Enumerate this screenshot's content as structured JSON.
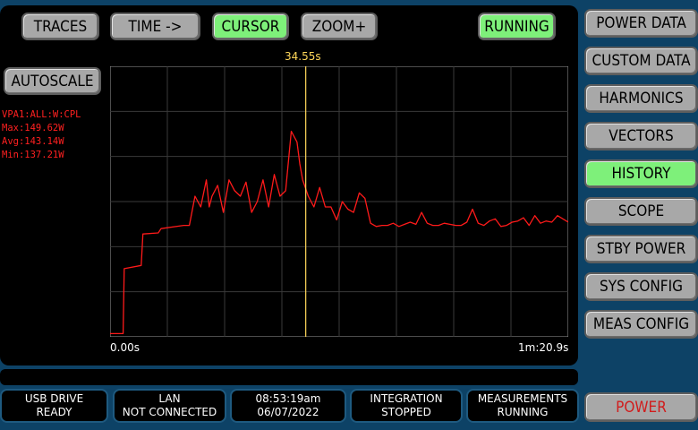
{
  "toolbar": {
    "traces": "TRACES",
    "time": "TIME ->",
    "cursor": "CURSOR",
    "zoom": "ZOOM+",
    "running": "RUNNING"
  },
  "autoscale": "AUTOSCALE",
  "stats": {
    "channel": "VPA1:ALL:W:CPL",
    "max": "Max:149.62W",
    "avg": "Avg:143.14W",
    "min": "Min:137.21W"
  },
  "cursor_time": "34.55s",
  "colors": {
    "trace": "#ff1a1a",
    "cursor": "#ffd75a",
    "active_button": "#7ef07a",
    "button": "#a8a8a8",
    "background": "#0d4266"
  },
  "chart_data": {
    "type": "line",
    "title": "",
    "xlabel": "",
    "ylabel": "",
    "x_start_label": "0.00s",
    "x_end_label": "1m:20.9s",
    "xlim": [
      0,
      80.9
    ],
    "ylim": [
      130,
      155
    ],
    "grid": true,
    "cursor_x": 34.55,
    "series": [
      {
        "x": [
          0,
          2.3,
          2.5,
          5.5,
          5.8,
          8.5,
          9,
          13,
          14,
          15,
          16,
          17,
          17.5,
          18,
          19,
          20,
          21,
          22,
          23,
          24,
          25,
          26,
          27,
          28,
          29,
          30,
          31,
          32,
          33,
          33.5,
          34,
          35,
          36,
          37,
          38,
          39,
          40,
          41,
          42,
          43,
          44,
          45,
          46,
          47,
          48,
          49,
          50,
          51,
          52,
          53,
          54,
          55,
          56,
          57,
          58,
          59,
          60,
          61,
          62,
          63,
          64,
          65,
          66,
          67,
          68,
          69,
          70,
          71,
          72,
          73,
          74,
          75,
          76,
          77,
          78,
          79,
          80.9
        ],
        "values": [
          130.3,
          130.3,
          136.3,
          136.6,
          139.5,
          139.6,
          140,
          140.3,
          140.3,
          143,
          142,
          144.5,
          142,
          143,
          144,
          141.5,
          144.5,
          143.5,
          143,
          144.3,
          141.5,
          142.5,
          144.5,
          142,
          145,
          143,
          143.5,
          149,
          148,
          146,
          144.5,
          143,
          142,
          143.8,
          142,
          142,
          140.8,
          142.5,
          141.8,
          141.5,
          143.3,
          142.8,
          140.5,
          140.2,
          140.3,
          140.3,
          140.5,
          140.2,
          140.4,
          140.6,
          140.4,
          141.5,
          140.5,
          140.3,
          140.3,
          140.5,
          140.4,
          140.3,
          140.3,
          140.6,
          141.8,
          140.5,
          140.3,
          140.7,
          140.9,
          140.2,
          140.3,
          140.6,
          140.7,
          141,
          140.3,
          141.2,
          140.5,
          140.7,
          140.6,
          141.2,
          140.6
        ]
      }
    ]
  },
  "sidebar": {
    "items": [
      {
        "label": "POWER DATA",
        "active": false
      },
      {
        "label": "CUSTOM DATA",
        "active": false
      },
      {
        "label": "HARMONICS",
        "active": false
      },
      {
        "label": "VECTORS",
        "active": false
      },
      {
        "label": "HISTORY",
        "active": true
      },
      {
        "label": "SCOPE",
        "active": false
      },
      {
        "label": "STBY POWER",
        "active": false
      },
      {
        "label": "SYS CONFIG",
        "active": false
      },
      {
        "label": "MEAS CONFIG",
        "active": false
      }
    ],
    "power": "POWER"
  },
  "statusbar": {
    "usb": {
      "line1": "USB DRIVE",
      "line2": "READY"
    },
    "lan": {
      "line1": "LAN",
      "line2": "NOT CONNECTED"
    },
    "clock": {
      "line1": "08:53:19am",
      "line2": "06/07/2022"
    },
    "integration": {
      "line1": "INTEGRATION",
      "line2": "STOPPED"
    },
    "measurements": {
      "line1": "MEASUREMENTS",
      "line2": "RUNNING"
    }
  }
}
